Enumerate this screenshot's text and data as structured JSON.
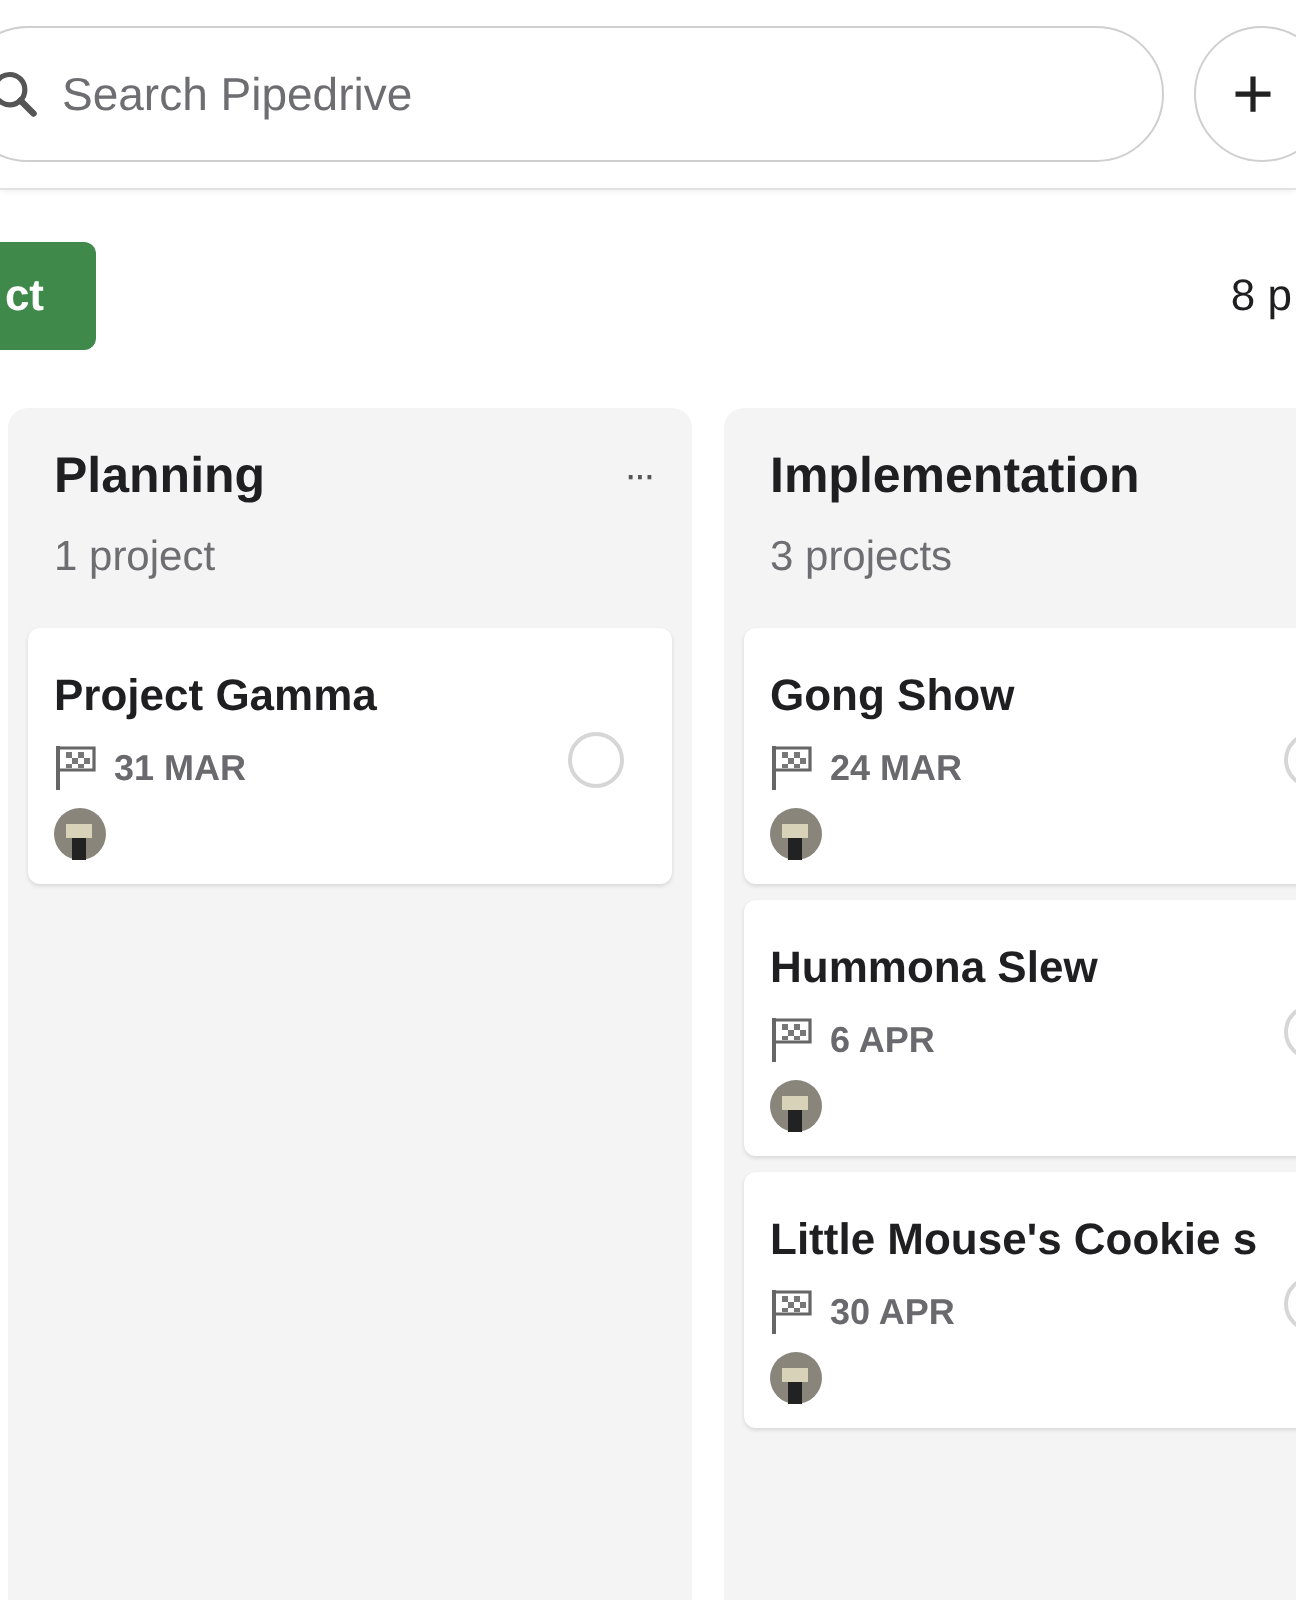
{
  "search": {
    "placeholder": "Search Pipedrive"
  },
  "add_button": {
    "label": "+"
  },
  "primary_button": {
    "label": "ct"
  },
  "project_count": "8 p",
  "columns": [
    {
      "title": "Planning",
      "count": "1 project",
      "menu": "···",
      "cards": [
        {
          "title": "Project Gamma",
          "date": "31 MAR",
          "done": false
        }
      ]
    },
    {
      "title": "Implementation",
      "count": "3 projects",
      "cards": [
        {
          "title": "Gong Show",
          "date": "24 MAR",
          "done": false
        },
        {
          "title": "Hummona Slew",
          "date": "6 APR",
          "done": false
        },
        {
          "title": "Little Mouse's Cookie s",
          "date": "30 APR",
          "done": false
        }
      ]
    }
  ]
}
